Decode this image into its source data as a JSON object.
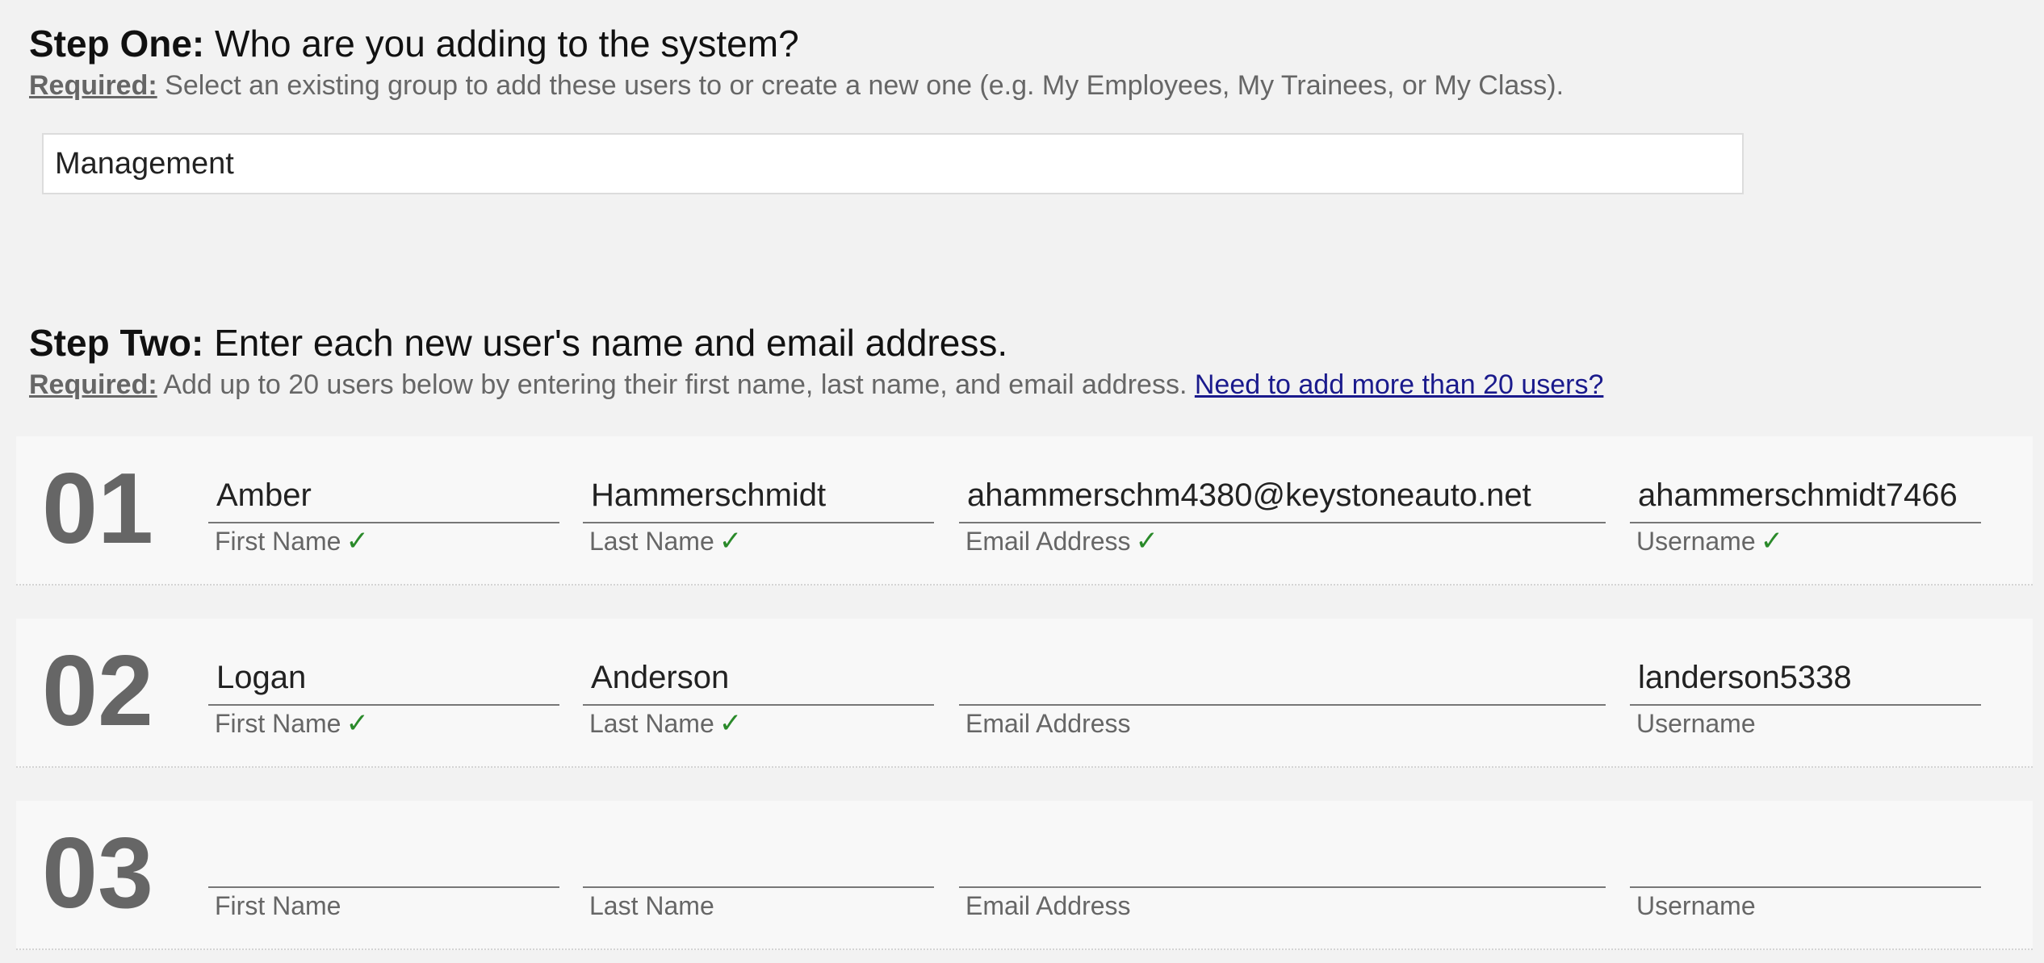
{
  "step_one": {
    "label": "Step One:",
    "question": "Who are you adding to the system?",
    "required_label": "Required:",
    "instructions": "Select an existing group to add these users to or create a new one (e.g. My Employees, My Trainees, or My Class).",
    "group_value": "Management"
  },
  "step_two": {
    "label": "Step Two:",
    "question": "Enter each new user's name and email address.",
    "required_label": "Required:",
    "instructions": "Add up to 20 users below by entering their first name, last name, and email address.",
    "more_link": "Need to add more than 20 users?"
  },
  "field_labels": {
    "first_name": "First Name",
    "last_name": "Last Name",
    "email": "Email Address",
    "username": "Username"
  },
  "check_mark": "✓",
  "check_color": "#2a8a2a",
  "rows": [
    {
      "number": "01",
      "first_name": "Amber",
      "first_valid": true,
      "last_name": "Hammerschmidt",
      "last_valid": true,
      "email": "ahammerschm4380@keystoneauto.net",
      "email_valid": true,
      "username": "ahammerschmidt7466",
      "username_valid": true
    },
    {
      "number": "02",
      "first_name": "Logan",
      "first_valid": true,
      "last_name": "Anderson",
      "last_valid": true,
      "email": "",
      "email_valid": false,
      "username": "landerson5338",
      "username_valid": false
    },
    {
      "number": "03",
      "first_name": "",
      "first_valid": false,
      "last_name": "",
      "last_valid": false,
      "email": "",
      "email_valid": false,
      "username": "",
      "username_valid": false
    }
  ]
}
